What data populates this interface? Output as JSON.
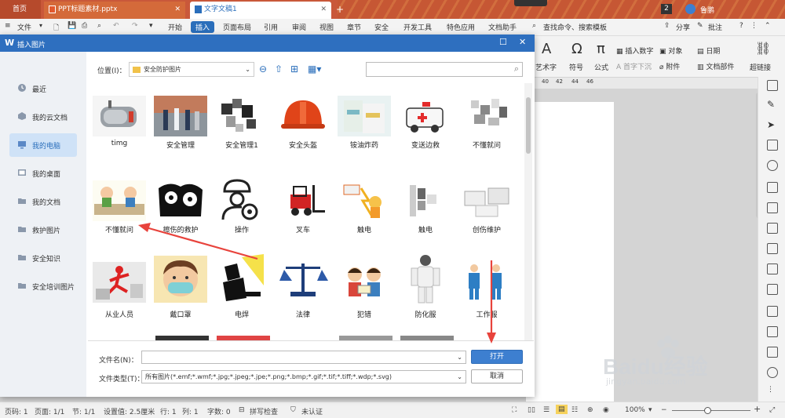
{
  "tabs": {
    "home": "首页",
    "ppt": "PPT标题素材.pptx",
    "doc": "文字文稿1",
    "count": "2",
    "user": "鲁鹏"
  },
  "menubar": {
    "file": "文件",
    "items": [
      "开始",
      "插入",
      "页面布局",
      "引用",
      "审阅",
      "视图",
      "章节",
      "安全",
      "开发工具",
      "特色应用",
      "文档助手"
    ],
    "search": "查找命令、搜索模板",
    "share": "分享",
    "comment": "批注"
  },
  "ribbon": {
    "art_text": "艺术字",
    "symbol": "符号",
    "formula": "公式",
    "insert_number": "插入数字",
    "object": "对象",
    "date": "日期",
    "first_sink": "首字下沉",
    "attachment": "附件",
    "doc_parts": "文档部件",
    "hyperlink": "超链接"
  },
  "ruler": [
    "40",
    "42",
    "44",
    "46"
  ],
  "dialog": {
    "title": "插入图片",
    "location_label": "位置(I)：",
    "location_value": "安全防护图片",
    "sidebar": [
      {
        "label": "最近",
        "icon": "clock-icon"
      },
      {
        "label": "我的云文档",
        "icon": "cloud-icon"
      },
      {
        "label": "我的电脑",
        "icon": "computer-icon"
      },
      {
        "label": "我的桌面",
        "icon": "desktop-icon"
      },
      {
        "label": "我的文档",
        "icon": "folder-icon"
      },
      {
        "label": "救护图片",
        "icon": "folder-icon"
      },
      {
        "label": "安全知识",
        "icon": "folder-icon"
      },
      {
        "label": "安全培训图片",
        "icon": "folder-icon"
      }
    ],
    "files": [
      "timg",
      "安全管理",
      "安全管理1",
      "安全头盔",
      "铵油炸药",
      "变送边救",
      "不懂就问",
      "不懂就问",
      "擦伤的救护",
      "操作",
      "叉车",
      "触电",
      "触电",
      "创伤维护",
      "从业人员",
      "戴口罩",
      "电焊",
      "法律",
      "犯错",
      "防化服",
      "工作服"
    ],
    "filename_label": "文件名(N)：",
    "filename_value": "",
    "filetype_label": "文件类型(T)：",
    "filetype_value": "所有图片(*.emf;*.wmf;*.jpg;*.jpeg;*.jpe;*.png;*.bmp;*.gif;*.tif;*.tiff;*.wdp;*.svg)",
    "open": "打开",
    "cancel": "取消"
  },
  "status": {
    "page_num": "页码: 1",
    "pages": "页面: 1/1",
    "section": "节: 1/1",
    "setting": "设置值: 2.5厘米",
    "row": "行: 1",
    "col": "列: 1",
    "words": "字数: 0",
    "spell": "拼写检查",
    "cert": "未认证",
    "zoom": "100%"
  },
  "watermark": {
    "brand": "Baidu经验",
    "url": "jingyan.baidu.com"
  },
  "colors": {
    "accent": "#2a6ebb",
    "dialog_header": "#2e6fbf",
    "open_button": "#3d7fd0",
    "arrow": "#e8433c"
  }
}
